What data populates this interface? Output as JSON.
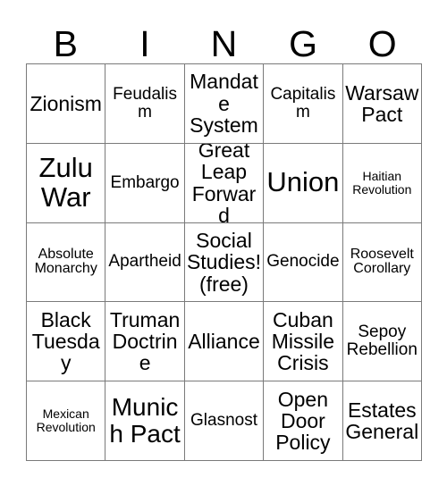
{
  "header": {
    "letters": [
      "B",
      "I",
      "N",
      "G",
      "O"
    ]
  },
  "colors": {
    "grid_line": "#7a7a7a",
    "cell_background": "#ffffff",
    "text": "#000000",
    "page_background": "#ffffff"
  },
  "grid": {
    "columns": 5,
    "rows": 5,
    "free_space_index": 12,
    "cells": [
      {
        "text": "Zionism",
        "size": "fs-md"
      },
      {
        "text": "Feudalism",
        "size": "fs-sm"
      },
      {
        "text": "Mandate System",
        "size": "fs-md"
      },
      {
        "text": "Capitalism",
        "size": "fs-sm"
      },
      {
        "text": "Warsaw Pact",
        "size": "fs-md"
      },
      {
        "text": "Zulu War",
        "size": "fs-xl"
      },
      {
        "text": "Embargo",
        "size": "fs-sm"
      },
      {
        "text": "Great Leap Forward",
        "size": "fs-md"
      },
      {
        "text": "Union",
        "size": "fs-xl"
      },
      {
        "text": "Haitian Revolution",
        "size": "fs-xxs"
      },
      {
        "text": "Absolute Monarchy",
        "size": "fs-xs"
      },
      {
        "text": "Apartheid",
        "size": "fs-sm"
      },
      {
        "text": "Social Studies! (free)",
        "size": "fs-md"
      },
      {
        "text": "Genocide",
        "size": "fs-sm"
      },
      {
        "text": "Roosevelt Corollary",
        "size": "fs-xs"
      },
      {
        "text": "Black Tuesday",
        "size": "fs-md"
      },
      {
        "text": "Truman Doctrine",
        "size": "fs-md"
      },
      {
        "text": "Alliance",
        "size": "fs-md"
      },
      {
        "text": "Cuban Missile Crisis",
        "size": "fs-md"
      },
      {
        "text": "Sepoy Rebellion",
        "size": "fs-sm"
      },
      {
        "text": "Mexican Revolution",
        "size": "fs-xxs"
      },
      {
        "text": "Munich Pact",
        "size": "fs-lg"
      },
      {
        "text": "Glasnost",
        "size": "fs-sm"
      },
      {
        "text": "Open Door Policy",
        "size": "fs-md"
      },
      {
        "text": "Estates General",
        "size": "fs-md"
      }
    ]
  }
}
